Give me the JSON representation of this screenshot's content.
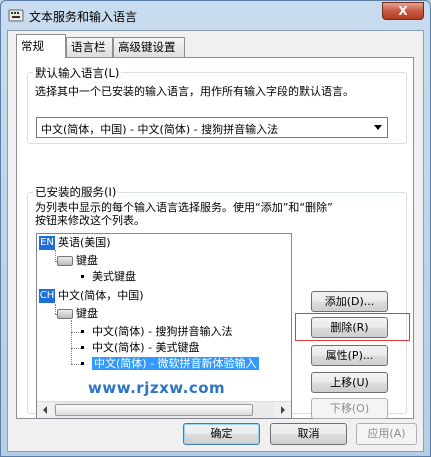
{
  "window": {
    "title": "文本服务和输入语言",
    "close_label": "X"
  },
  "tabs": [
    {
      "label": "常规",
      "active": true
    },
    {
      "label": "语言栏",
      "active": false
    },
    {
      "label": "高级键设置",
      "active": false
    }
  ],
  "default_input": {
    "group_title": "默认输入语言(L)",
    "description": "选择其中一个已安装的输入语言，用作所有输入字段的默认语言。",
    "selected": "中文(简体，中国) - 中文(简体) - 搜狗拼音输入法"
  },
  "installed_services": {
    "group_title": "已安装的服务(I)",
    "description_line1": "为列表中显示的每个输入语言选择服务。使用“添加”和“删除”",
    "description_line2": "按钮来修改这个列表。",
    "tree": {
      "en_badge": "EN",
      "en_label": "英语(美国)",
      "en_keyboard": "键盘",
      "en_us_keyboard": "美式键盘",
      "ch_badge": "CH",
      "ch_label": "中文(简体，中国)",
      "ch_keyboard": "键盘",
      "ch_items": [
        "中文(简体) - 搜狗拼音输入法",
        "中文(简体) - 美式键盘",
        "中文(简体) - 微软拼音新体验输入"
      ]
    },
    "buttons": {
      "add": "添加(D)...",
      "remove": "删除(R)",
      "properties": "属性(P)...",
      "move_up": "上移(U)",
      "move_down": "下移(O)"
    }
  },
  "watermark": "www.rjzxw.com",
  "footer": {
    "ok": "确定",
    "cancel": "取消",
    "apply": "应用(A)"
  },
  "colors": {
    "selection": "#3399ff",
    "highlight_box": "#e23b3b",
    "watermark": "#2d73c6"
  }
}
